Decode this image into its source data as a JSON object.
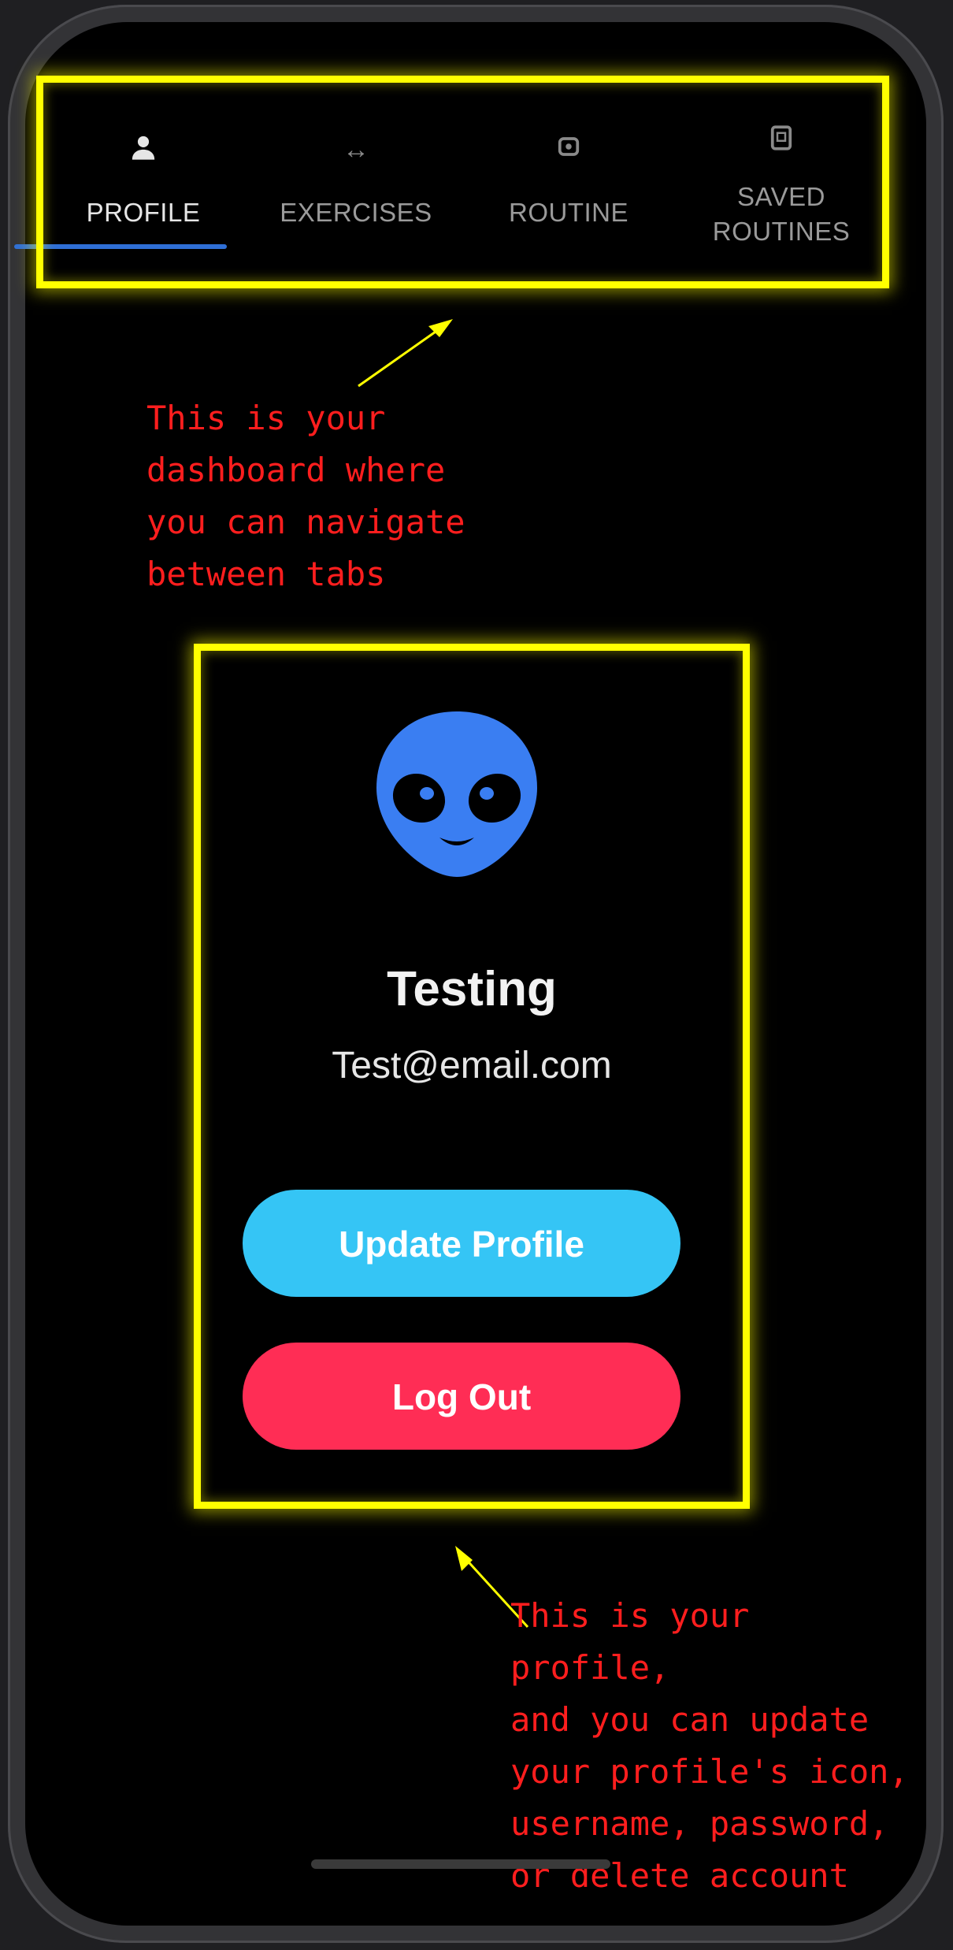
{
  "tabs": [
    {
      "label": "PROFILE",
      "icon": "person-icon",
      "glyph": "♟",
      "active": true
    },
    {
      "label": "EXERCISES",
      "icon": "arrows-horizontal-icon",
      "glyph": "↔",
      "active": false
    },
    {
      "label": "ROUTINE",
      "icon": "clipboard-icon",
      "glyph": "◘",
      "active": false
    },
    {
      "label": "SAVED\nROUTINES",
      "icon": "saved-icon",
      "glyph": "☑",
      "active": false
    }
  ],
  "profile": {
    "avatar_icon": "alien-face-icon",
    "avatar_color": "#3a7ef2",
    "username": "Testing",
    "email": "Test@email.com",
    "update_button": "Update Profile",
    "logout_button": "Log Out"
  },
  "annotations": {
    "tabs_note": "This is your\ndashboard where\nyou can navigate\nbetween tabs",
    "profile_note": "This is your profile,\nand you can update\nyour profile's icon,\nusername, password,\nor delete account"
  },
  "colors": {
    "highlight": "#ffff00",
    "annotation_text": "#ff1e1e",
    "tab_indicator": "#2f6fd6",
    "update_button": "#35c5f5",
    "logout_button": "#ff2d55"
  }
}
